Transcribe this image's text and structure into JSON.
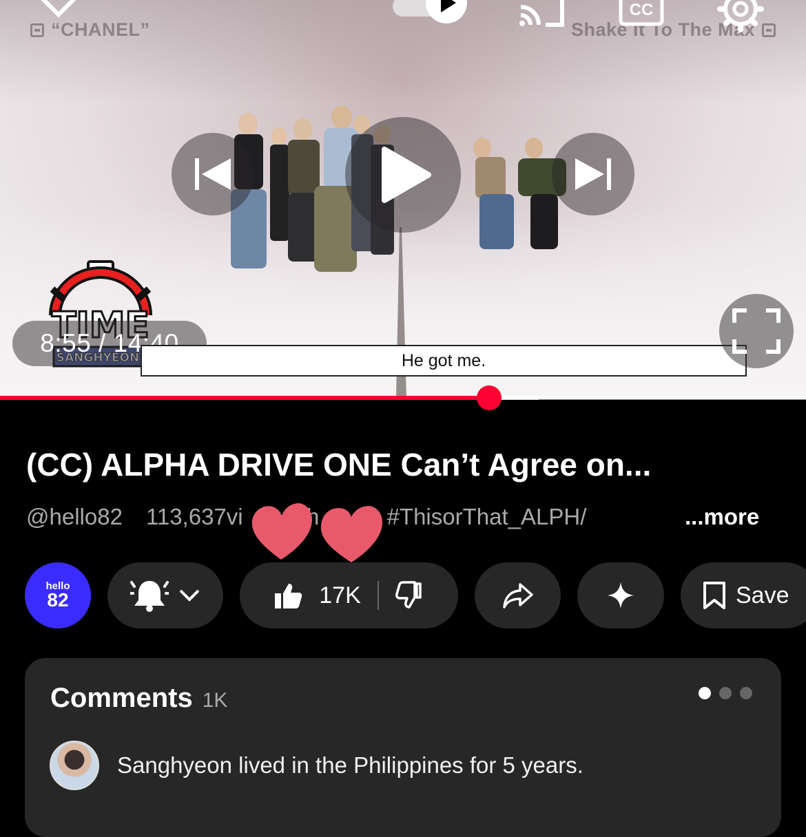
{
  "player": {
    "left_label": "“CHANEL”",
    "right_label": "Shake It To The Max",
    "overlay_logo_word": "TIME",
    "overlay_logo_name": "SANGHYEON",
    "time_display": "8:55 / 14:40",
    "subtitle": "He got me.",
    "progress_fraction": 0.607,
    "buffer_fraction": 0.668,
    "accent_color": "#ff0033"
  },
  "video": {
    "title": "(CC) ALPHA DRIVE ONE Can’t Agree on...",
    "channel_handle": "@hello82",
    "views": "113,637",
    "views_suffix_visible": "vi",
    "age_visible": "5h ago",
    "hashtag": "#ThisorThat_ALPH/",
    "more_label": "...more"
  },
  "channel_avatar": {
    "line1": "hello",
    "line2": "82",
    "color": "#3a2bff"
  },
  "actions": {
    "like_count": "17K",
    "save_label": "Save"
  },
  "comments": {
    "title": "Comments",
    "count": "1K",
    "top_comment": "Sanghyeon lived in the Philippines for 5 years."
  }
}
